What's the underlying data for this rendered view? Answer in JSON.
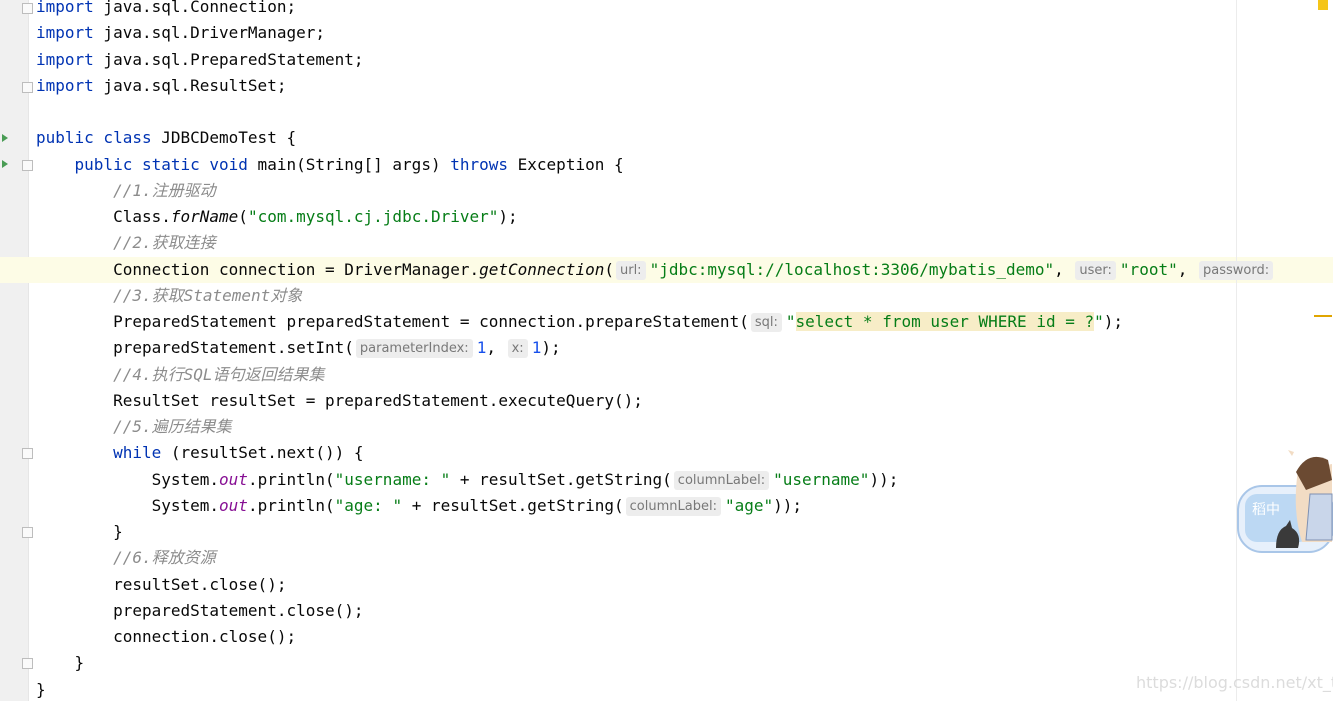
{
  "editor": {
    "lines": [
      [
        {
          "t": "import",
          "c": "kw"
        },
        {
          "t": " java.sql.Connection;"
        }
      ],
      [
        {
          "t": "import",
          "c": "kw"
        },
        {
          "t": " java.sql.DriverManager;"
        }
      ],
      [
        {
          "t": "import",
          "c": "kw"
        },
        {
          "t": " java.sql.PreparedStatement;"
        }
      ],
      [
        {
          "t": "import",
          "c": "kw"
        },
        {
          "t": " java.sql.ResultSet;"
        }
      ],
      [],
      [
        {
          "t": "public class",
          "c": "kw"
        },
        {
          "t": " JDBCDemoTest {"
        }
      ],
      [
        {
          "t": "    "
        },
        {
          "t": "public static void",
          "c": "kw"
        },
        {
          "t": " main(String[] args) "
        },
        {
          "t": "throws",
          "c": "kw"
        },
        {
          "t": " Exception {"
        }
      ],
      [
        {
          "t": "        "
        },
        {
          "t": "//1.注册驱动",
          "c": "cm"
        }
      ],
      [
        {
          "t": "        Class."
        },
        {
          "t": "forName",
          "c": "ital"
        },
        {
          "t": "("
        },
        {
          "t": "\"com.mysql.cj.jdbc.Driver\"",
          "c": "st"
        },
        {
          "t": ");"
        }
      ],
      [
        {
          "t": "        "
        },
        {
          "t": "//2.获取连接",
          "c": "cm"
        }
      ],
      [
        {
          "t": "        Connection connection = DriverManager."
        },
        {
          "t": "getConnection",
          "c": "ital"
        },
        {
          "t": "("
        },
        {
          "h": "url:"
        },
        {
          "t": "\"jdbc:mysql://localhost:3306/mybatis_demo\"",
          "c": "st"
        },
        {
          "t": ", "
        },
        {
          "h": "user:"
        },
        {
          "t": "\"root\"",
          "c": "st"
        },
        {
          "t": ", "
        },
        {
          "h": "password:"
        }
      ],
      [
        {
          "t": "        "
        },
        {
          "t": "//3.获取Statement对象",
          "c": "cm"
        }
      ],
      [
        {
          "t": "        PreparedStatement preparedStatement = connection.prepareStatement("
        },
        {
          "h": "sql:"
        },
        {
          "t": "\"",
          "c": "st"
        },
        {
          "t": "select * from user WHERE id = ?",
          "c": "st hl"
        },
        {
          "t": "\"",
          "c": "st"
        },
        {
          "t": ");"
        }
      ],
      [
        {
          "t": "        preparedStatement.setInt("
        },
        {
          "h": "parameterIndex:"
        },
        {
          "t": "1",
          "c": "num"
        },
        {
          "t": ", "
        },
        {
          "h": "x:"
        },
        {
          "t": "1",
          "c": "num"
        },
        {
          "t": ");"
        }
      ],
      [
        {
          "t": "        "
        },
        {
          "t": "//4.执行SQL语句返回结果集",
          "c": "cm"
        }
      ],
      [
        {
          "t": "        ResultSet resultSet = preparedStatement.executeQuery();"
        }
      ],
      [
        {
          "t": "        "
        },
        {
          "t": "//5.遍历结果集",
          "c": "cm"
        }
      ],
      [
        {
          "t": "        "
        },
        {
          "t": "while",
          "c": "kw"
        },
        {
          "t": " (resultSet.next()) {"
        }
      ],
      [
        {
          "t": "            System."
        },
        {
          "t": "out",
          "c": "fld"
        },
        {
          "t": ".println("
        },
        {
          "t": "\"username: \"",
          "c": "st"
        },
        {
          "t": " + resultSet.getString("
        },
        {
          "h": "columnLabel:"
        },
        {
          "t": "\"username\"",
          "c": "st"
        },
        {
          "t": "));"
        }
      ],
      [
        {
          "t": "            System."
        },
        {
          "t": "out",
          "c": "fld"
        },
        {
          "t": ".println("
        },
        {
          "t": "\"age: \"",
          "c": "st"
        },
        {
          "t": " + resultSet.getString("
        },
        {
          "h": "columnLabel:"
        },
        {
          "t": "\"age\"",
          "c": "st"
        },
        {
          "t": "));"
        }
      ],
      [
        {
          "t": "        }"
        }
      ],
      [
        {
          "t": "        "
        },
        {
          "t": "//6.释放资源",
          "c": "cm"
        }
      ],
      [
        {
          "t": "        resultSet.close();"
        }
      ],
      [
        {
          "t": "        preparedStatement.close();"
        }
      ],
      [
        {
          "t": "        connection.close();"
        }
      ],
      [
        {
          "t": "    }"
        }
      ],
      [
        {
          "t": "}"
        }
      ]
    ]
  },
  "colors": {
    "keyword": "#0033b3",
    "string": "#067d17",
    "comment": "#8c8c8c",
    "number": "#1750eb",
    "field": "#871094",
    "current_line": "#fdfce6",
    "sql_highlight": "#f7edc7"
  },
  "widget": {
    "label": "稻中"
  },
  "watermark": "https://blog.csdn.net/xt_tao"
}
